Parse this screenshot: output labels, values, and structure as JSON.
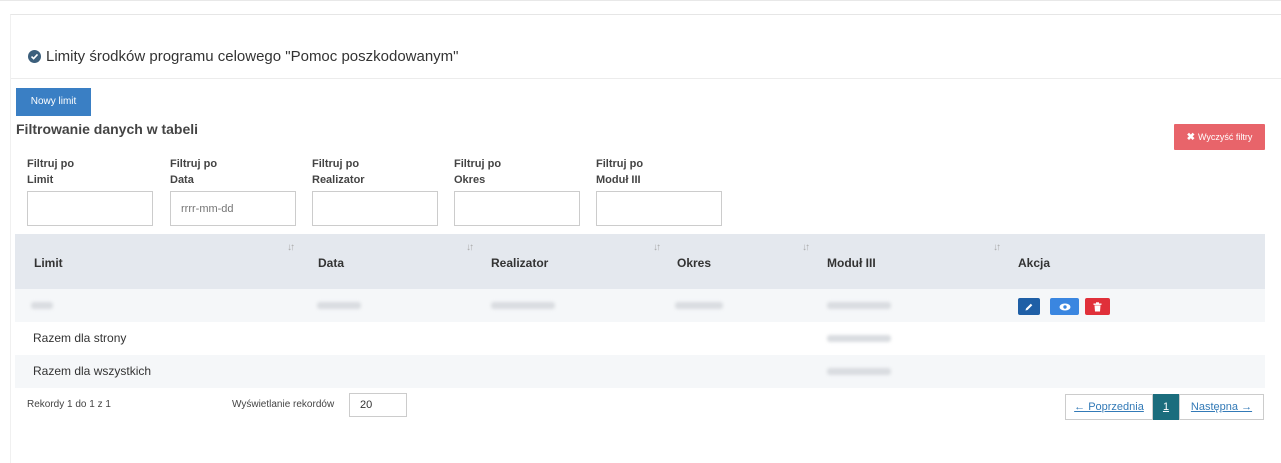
{
  "header": {
    "title": "Limity środków programu celowego \"Pomoc poszkodowanym\""
  },
  "toolbar": {
    "new_label": "Nowy limit",
    "clear_label": "Wyczyść filtry",
    "clear_icon": "x-icon"
  },
  "filters": {
    "title": "Filtrowanie danych w tabeli",
    "items": [
      {
        "label_line1": "Filtruj po",
        "label_line2": "Limit",
        "placeholder": ""
      },
      {
        "label_line1": "Filtruj po",
        "label_line2": "Data",
        "placeholder": "rrrr-mm-dd"
      },
      {
        "label_line1": "Filtruj po",
        "label_line2": "Realizator",
        "placeholder": ""
      },
      {
        "label_line1": "Filtruj po",
        "label_line2": "Okres",
        "placeholder": ""
      },
      {
        "label_line1": "Filtruj po",
        "label_line2": "Moduł III",
        "placeholder": ""
      }
    ]
  },
  "table": {
    "columns": [
      "Limit",
      "Data",
      "Realizator",
      "Okres",
      "Moduł III",
      "Akcja"
    ],
    "sort_icon": "sort-icon",
    "summary_page": "Razem dla strony",
    "summary_all": "Razem dla wszystkich"
  },
  "footer": {
    "records": "Rekordy 1 do 1 z 1",
    "show_label": "Wyświetlanie rekordów",
    "show_value": "20"
  },
  "pagination": {
    "prev": "← Poprzednia",
    "current": "1",
    "next": "Następna →"
  },
  "colors": {
    "primary": "#3a7fc4",
    "danger": "#e8646a",
    "active_page": "#1b6d7d",
    "header_bg": "#e4e8ee"
  }
}
